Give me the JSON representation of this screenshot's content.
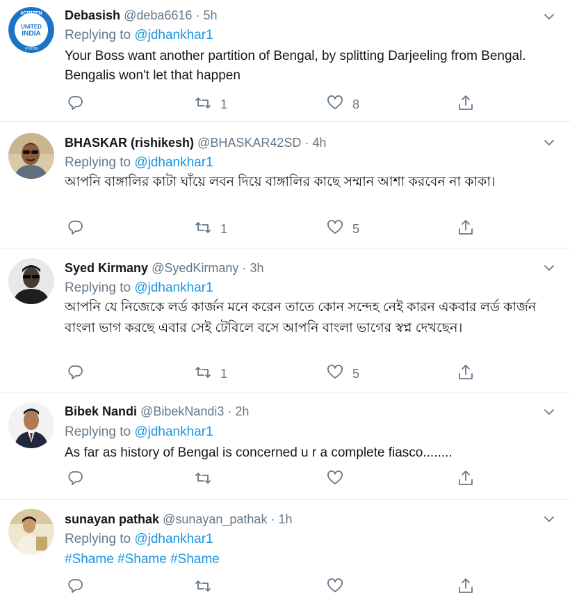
{
  "tweets": [
    {
      "name": "Debasish",
      "handle": "@deba6616",
      "sep": "·",
      "time": "5h",
      "replying_label": "Replying to",
      "replying_to": "@jdhankhar1",
      "text": "Your Boss want another partition of Bengal, by splitting Darjeeling from Bengal. Bengalis won't let that happen",
      "retweets": "1",
      "likes": "8",
      "avatar_badge": "#CITIZEN UNITED INDIA নাগরিক"
    },
    {
      "name": "BHASKAR (rishikesh)",
      "handle": "@BHASKAR42SD",
      "sep": "·",
      "time": "4h",
      "replying_label": "Replying to",
      "replying_to": "@jdhankhar1",
      "text": "আপনি বাঙ্গালির কাটা ঘাঁয়ে লবন দিয়ে বাঙ্গালির কাছে সম্মান আশা করবেন না কাকা।",
      "retweets": "1",
      "likes": "5"
    },
    {
      "name": "Syed Kirmany",
      "handle": "@SyedKirmany",
      "sep": "·",
      "time": "3h",
      "replying_label": "Replying to",
      "replying_to": "@jdhankhar1",
      "text": "আপনি যে নিজেকে লর্ড কার্জন মনে করেন তাতে কোন সন্দেহ নেই কারন একবার লর্ড কার্জন বাংলা ভাগ করছে এবার সেই টেবিলে বসে আপনি বাংলা ভাগের স্বপ্ন দেখছেন।",
      "retweets": "1",
      "likes": "5"
    },
    {
      "name": "Bibek Nandi",
      "handle": "@BibekNandi3",
      "sep": "·",
      "time": "2h",
      "replying_label": "Replying to",
      "replying_to": "@jdhankhar1",
      "text": "As far as history of Bengal is concerned u r a complete fiasco........",
      "retweets": "",
      "likes": ""
    },
    {
      "name": "sunayan pathak",
      "handle": "@sunayan_pathak",
      "sep": "·",
      "time": "1h",
      "replying_label": "Replying to",
      "replying_to": "@jdhankhar1",
      "text": "#Shame #Shame #Shame",
      "retweets": "",
      "likes": ""
    }
  ],
  "icons": {
    "reply": "reply-icon",
    "retweet": "retweet-icon",
    "like": "like-icon",
    "share": "share-icon",
    "menu": "chevron-down-icon"
  },
  "colors": {
    "link": "#1b95e0",
    "muted": "#657786",
    "text": "#14171a",
    "divider": "#e6ecf0"
  }
}
